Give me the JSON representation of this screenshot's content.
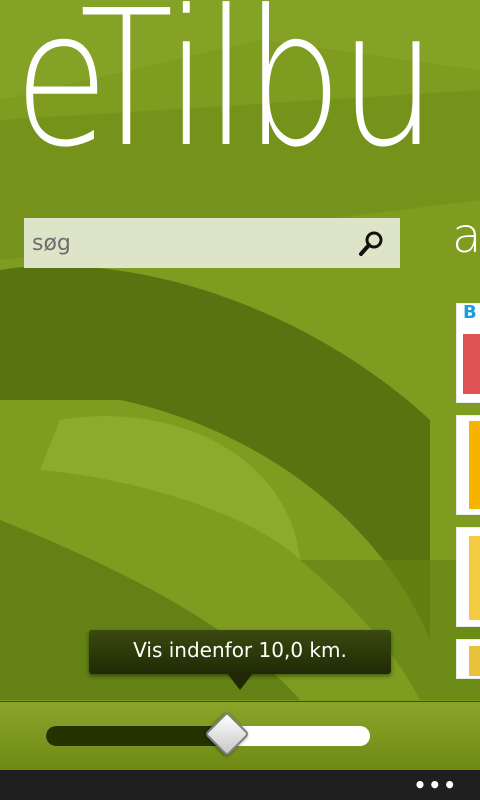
{
  "app": {
    "title": "eTilbu"
  },
  "search": {
    "placeholder": "søg"
  },
  "next_panel": {
    "header": "a"
  },
  "thumbnails": [
    {
      "label": "B",
      "color": "#1b9be0"
    },
    {
      "label": "",
      "color": "#f5b400"
    },
    {
      "label": "",
      "color": "#f2c21f"
    },
    {
      "label": "",
      "color": "#e8c23a"
    }
  ],
  "tooltip": {
    "text": "Vis indenfor 10,0 km."
  },
  "slider": {
    "value_fraction": 0.56
  },
  "app_bar": {
    "more_label": "•••"
  },
  "colors": {
    "background": "#7a9a1e",
    "search_bg": "#dde4c8",
    "slider_fill": "#233300",
    "app_bar": "#1f1f1f"
  }
}
